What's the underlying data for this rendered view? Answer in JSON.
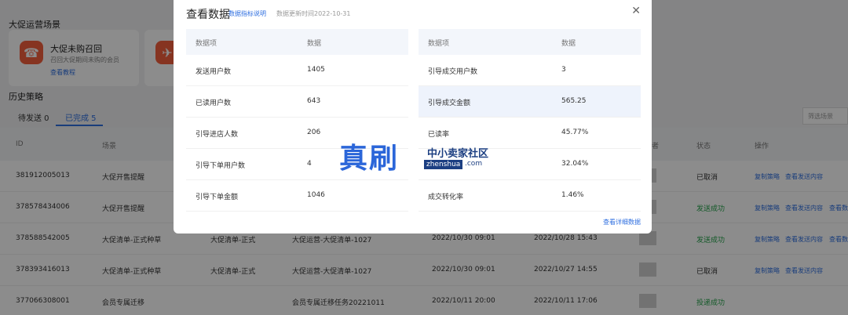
{
  "scenarios": {
    "title": "大促运营场景",
    "cards": [
      {
        "title": "大促未购召回",
        "desc": "召回大促期间未购的会员",
        "link": "查看教程"
      }
    ]
  },
  "history": {
    "title": "历史策略",
    "tabs": [
      {
        "label": "待发送 0"
      },
      {
        "label": "已完成 5"
      }
    ],
    "filter_placeholder": "筛选场景"
  },
  "table": {
    "headers": [
      "ID",
      "场景",
      "者",
      "状态",
      "操作"
    ],
    "rows": [
      {
        "id": "381912005013",
        "scene": "大促开售提醒",
        "name": "",
        "task": "",
        "start": "",
        "end": "",
        "status": "已取消",
        "status_color": "#333333",
        "ops": [
          "复制策略",
          "查看发送内容"
        ]
      },
      {
        "id": "378578434006",
        "scene": "大促开售提醒",
        "name": "",
        "task": "",
        "start": "",
        "end": "",
        "status": "发送成功",
        "status_color": "#23a34a",
        "ops": [
          "复制策略",
          "查看发送内容",
          "查看数"
        ]
      },
      {
        "id": "378588542005",
        "scene": "大促清单-正式种草",
        "name": "大促清单-正式",
        "task": "大促运营-大促清单-1027",
        "start": "2022/10/30 09:01",
        "end": "2022/10/28 15:43",
        "status": "发送成功",
        "status_color": "#23a34a",
        "ops": [
          "复制策略",
          "查看发送内容",
          "查看数"
        ]
      },
      {
        "id": "378393416013",
        "scene": "大促清单-正式种草",
        "name": "大促清单-正式",
        "task": "大促运营-大促清单-1027",
        "start": "2022/10/30 09:01",
        "end": "2022/10/27 14:55",
        "status": "已取消",
        "status_color": "#333333",
        "ops": [
          "复制策略",
          "查看发送内容"
        ]
      },
      {
        "id": "377066308001",
        "scene": "会员专属迁移",
        "name": "",
        "task": "会员专属迁移任务20221011",
        "start": "2022/10/11 20:00",
        "end": "2022/10/11 17:06",
        "status": "投递成功",
        "status_color": "#23a34a",
        "ops": []
      }
    ]
  },
  "modal": {
    "title": "查看数据",
    "help_link": "数据指标说明",
    "updated": "数据更新时间2022-10-31",
    "close_icon": "close-icon",
    "left_table": {
      "headers": [
        "数据项",
        "数据"
      ],
      "rows": [
        [
          "发送用户数",
          "1405"
        ],
        [
          "已读用户数",
          "643"
        ],
        [
          "引导进店人数",
          "206"
        ],
        [
          "引导下单用户数",
          "4"
        ],
        [
          "引导下单金额",
          "1046"
        ]
      ]
    },
    "right_table": {
      "headers": [
        "数据项",
        "数据"
      ],
      "rows": [
        [
          "引导成交用户数",
          "3"
        ],
        [
          "引导成交金额",
          "565.25"
        ],
        [
          "已读率",
          "45.77%"
        ],
        [
          "",
          "32.04%"
        ],
        [
          "成交转化率",
          "1.46%"
        ]
      ]
    },
    "detail_link": "查看详细数据"
  },
  "watermark": {
    "big": "真刷",
    "small": "中小卖家社区",
    "url": "zhenshua",
    "url2": ".com"
  }
}
